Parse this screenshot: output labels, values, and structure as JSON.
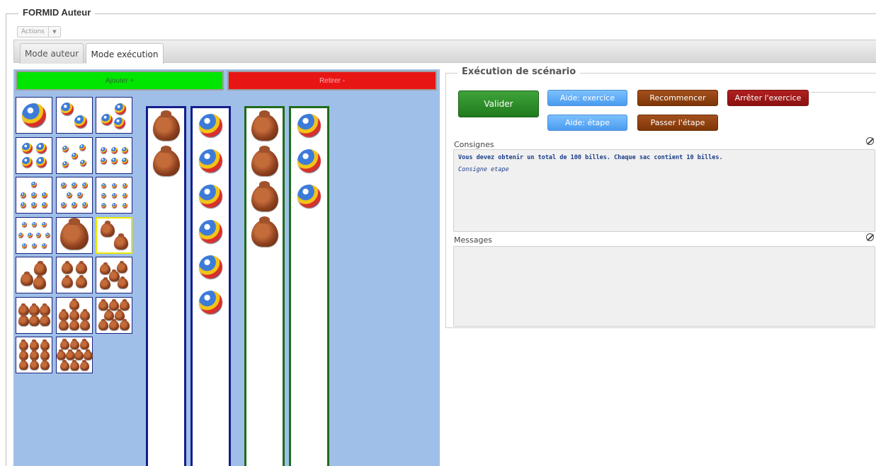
{
  "window": {
    "title": "FORMID Auteur"
  },
  "actions": {
    "label": "Actions"
  },
  "tabs": [
    {
      "label": "Mode auteur",
      "active": false
    },
    {
      "label": "Mode exécution",
      "active": true
    }
  ],
  "workspace": {
    "add_label": "Ajouter +",
    "remove_label": "Retirer -",
    "palette": [
      {
        "kind": "ball",
        "count": 1
      },
      {
        "kind": "ball",
        "count": 2
      },
      {
        "kind": "ball",
        "count": 3
      },
      {
        "kind": "ball",
        "count": 4
      },
      {
        "kind": "ball",
        "count": 5
      },
      {
        "kind": "ball",
        "count": 6
      },
      {
        "kind": "ball",
        "count": 7
      },
      {
        "kind": "ball",
        "count": 8
      },
      {
        "kind": "ball",
        "count": 9
      },
      {
        "kind": "ball",
        "count": 10
      },
      {
        "kind": "bag",
        "count": 1
      },
      {
        "kind": "bag",
        "count": 2,
        "selected": true
      },
      {
        "kind": "bag",
        "count": 3
      },
      {
        "kind": "bag",
        "count": 4
      },
      {
        "kind": "bag",
        "count": 5
      },
      {
        "kind": "bag",
        "count": 6
      },
      {
        "kind": "bag",
        "count": 7
      },
      {
        "kind": "bag",
        "count": 8
      },
      {
        "kind": "bag",
        "count": 9
      },
      {
        "kind": "bag",
        "count": 10
      }
    ],
    "columns": [
      {
        "color": "blue",
        "kind": "bag",
        "count": 2
      },
      {
        "color": "blue",
        "kind": "ball",
        "count": 6
      },
      {
        "color": "green",
        "kind": "bag",
        "count": 4
      },
      {
        "color": "green",
        "kind": "ball",
        "count": 3
      }
    ]
  },
  "execution": {
    "legend": "Exécution de scénario",
    "buttons": {
      "valider": "Valider",
      "aide_exercice": "Aide: exercice",
      "aide_etape": "Aide: étape",
      "recommencer": "Recommencer",
      "passer_etape": "Passer l'étape",
      "arreter": "Arrêter l'exercice"
    },
    "consignes_label": "Consignes",
    "consigne_main": "Vous devez obtenir un total de 100 billes. Chaque sac contient 10 billes.",
    "consigne_step": "Consigne etape",
    "messages_label": "Messages",
    "messages": ""
  },
  "colors": {
    "add": "#00e600",
    "remove": "#e81515",
    "workspace_bg": "#9fbfe8",
    "col_blue": "#141e8c",
    "col_green": "#1f6b1a",
    "btn_green": "#2b8f28",
    "btn_blue": "#5aa8f5",
    "btn_brown": "#8b3e0e",
    "btn_red": "#9c1515"
  }
}
